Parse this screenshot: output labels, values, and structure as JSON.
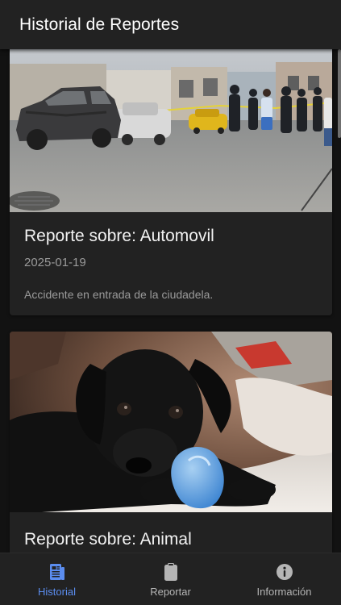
{
  "app": {
    "title": "Historial de Reportes"
  },
  "reports": [
    {
      "title": "Reporte sobre: Automovil",
      "date": "2025-01-19",
      "description": "Accidente en entrada de la ciudadela.",
      "image": "burned-car-photo"
    },
    {
      "title": "Reporte sobre: Animal",
      "image": "black-puppy-photo"
    }
  ],
  "nav": {
    "items": [
      {
        "label": "Historial",
        "icon": "document-icon",
        "active": true
      },
      {
        "label": "Reportar",
        "icon": "clipboard-icon",
        "active": false
      },
      {
        "label": "Información",
        "icon": "info-icon",
        "active": false
      }
    ]
  },
  "colors": {
    "background": "#121212",
    "surface": "#222222",
    "accent": "#5b8def",
    "muted_text": "#9a9a9a"
  }
}
